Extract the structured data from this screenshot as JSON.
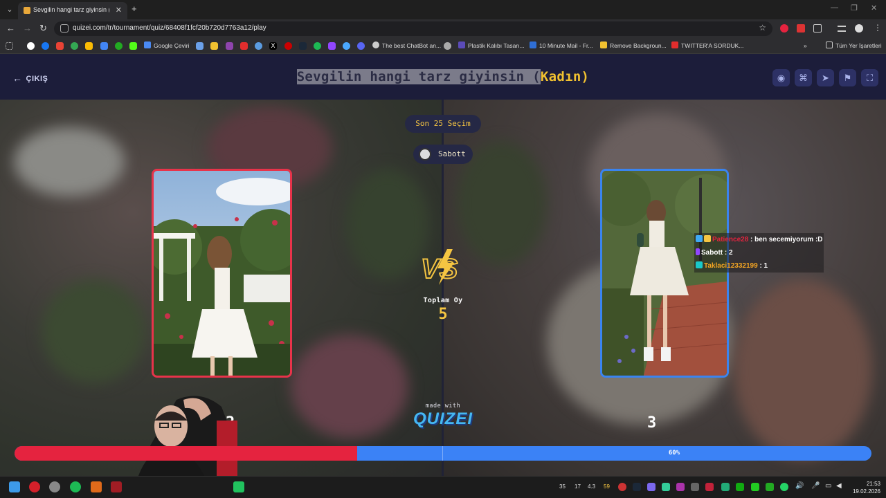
{
  "browser": {
    "tab_title": "Sevgilin hangi tarz giyinsin (Kadın)",
    "url": "quizei.com/tr/tournament/quiz/68408f1fcf20b720d7763a12/play",
    "bookmarks": [
      {
        "label": "Google Çeviri",
        "color": "#4a8af4"
      },
      {
        "label": "The best ChatBot an...",
        "color": "#cccccc"
      },
      {
        "label": "Plastik Kalıbı Tasarı...",
        "color": "#5b4bb8"
      },
      {
        "label": "10 Minute Mail - Fr...",
        "color": "#2f6fd6"
      },
      {
        "label": "Remove Backgroun...",
        "color": "#f2c230"
      },
      {
        "label": "TWITTER'A SORDUK...",
        "color": "#e22d2d"
      }
    ],
    "all_bookmarks_label": "Tüm Yer İşaretleri"
  },
  "header": {
    "back_label": "ÇIKIŞ",
    "title_main": "Sevgilin hangi tarz giyinsin (",
    "title_accent": "Kadın)"
  },
  "match": {
    "recent_choices_label": "Son 25 Seçim",
    "user_name": "Sabott",
    "total_votes_label": "Toplam Oy",
    "total_votes": "5",
    "left_votes": "2",
    "right_votes": "3",
    "right_percent_label": "60%",
    "left_fraction": 0.4,
    "colors": {
      "left": "#e5233f",
      "right": "#3b82f6",
      "accent": "#f5c542"
    }
  },
  "chat": [
    {
      "user": "Patience28",
      "message": " : ben secemiyorum :D",
      "color": "#e5233f"
    },
    {
      "user": "Sabott",
      "message": " : 2",
      "color": "#ffffff"
    },
    {
      "user": "Taklaci12332199",
      "message": " : 1",
      "color": "#f5a623"
    }
  ],
  "branding": {
    "made_with": "made with",
    "logo": "QUIZEI"
  },
  "taskbar": {
    "tray_numbers": [
      "35",
      "17",
      "4.3",
      "59"
    ],
    "time": "21:53",
    "date": "19.02.2026"
  }
}
